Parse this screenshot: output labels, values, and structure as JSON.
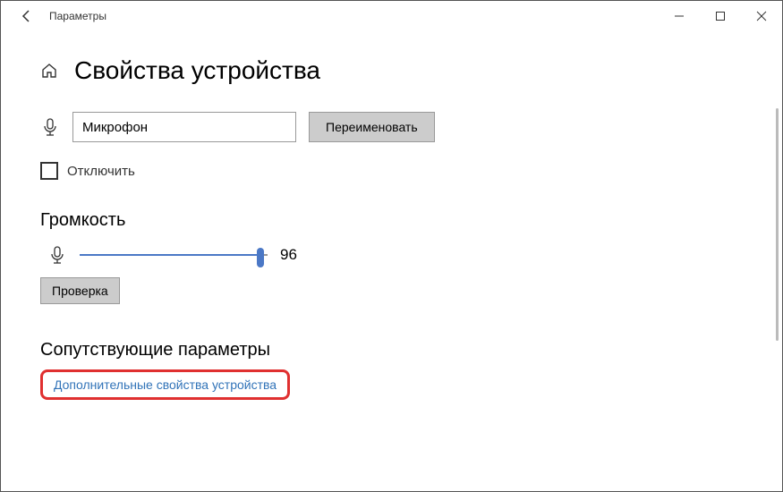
{
  "titlebar": {
    "title": "Параметры"
  },
  "page": {
    "heading": "Свойства устройства"
  },
  "device": {
    "name_value": "Микрофон",
    "rename_label": "Переименовать",
    "disable_label": "Отключить"
  },
  "volume": {
    "section_label": "Громкость",
    "value": 96,
    "test_label": "Проверка"
  },
  "related": {
    "section_label": "Сопутствующие параметры",
    "link_label": "Дополнительные свойства устройства"
  }
}
